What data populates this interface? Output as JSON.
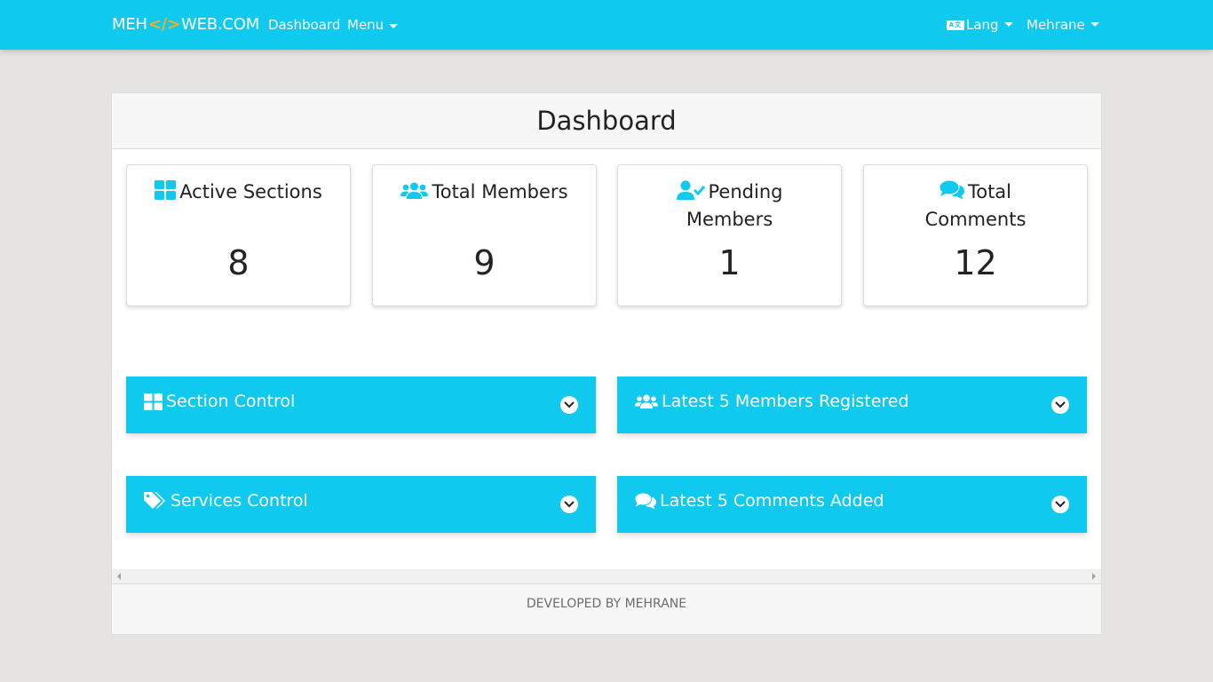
{
  "navbar": {
    "brand_left": "MEH",
    "brand_code": "</>",
    "brand_right": "WEB.COM",
    "dashboard_link": "Dashboard",
    "menu_link": "Menu",
    "lang_link": "Lang",
    "lang_icon_text": "A文",
    "user_link": "Mehrane"
  },
  "panel": {
    "title": "Dashboard"
  },
  "stats": [
    {
      "label": "Active Sections",
      "value": "8",
      "icon": "th-large-icon"
    },
    {
      "label": "Total Members",
      "value": "9",
      "icon": "users-icon"
    },
    {
      "label": "Pending Members",
      "value": "1",
      "icon": "user-check-icon"
    },
    {
      "label": "Total Comments",
      "value": "12",
      "icon": "comments-icon"
    }
  ],
  "accordions": [
    {
      "label": "Section Control",
      "icon": "th-large-icon"
    },
    {
      "label": "Latest 5 Members Registered",
      "icon": "users-icon"
    },
    {
      "label": "Services Control",
      "icon": "tags-icon"
    },
    {
      "label": "Latest 5 Comments Added",
      "icon": "comments-icon"
    }
  ],
  "footer": {
    "text": "DEVELOPED BY MEHRANE"
  },
  "colors": {
    "accent": "#0fc9ef",
    "brand_code": "#f2b01e",
    "background": "#e5e4e2"
  }
}
